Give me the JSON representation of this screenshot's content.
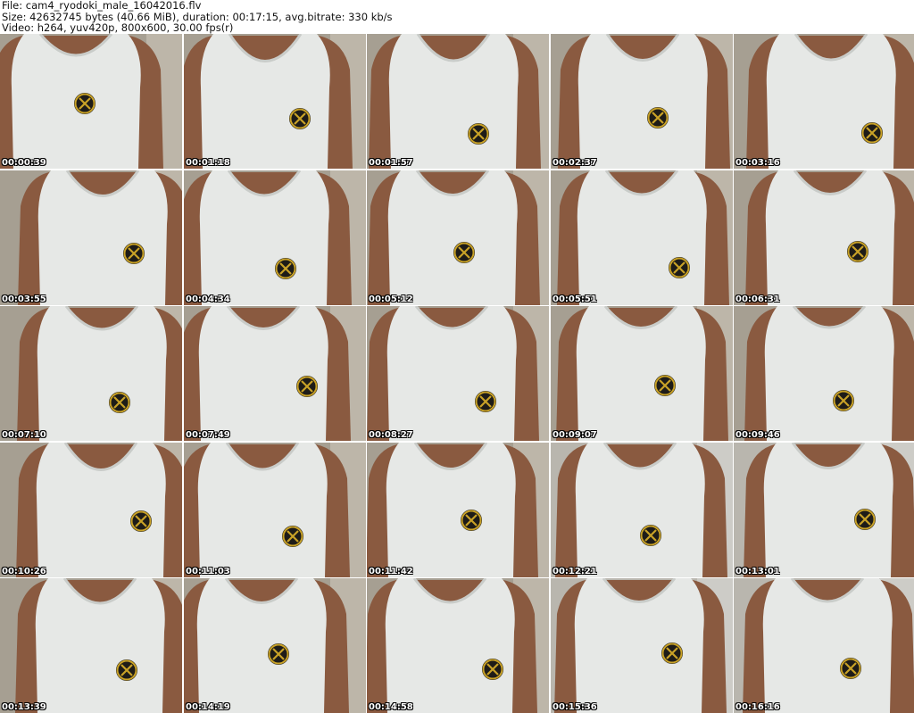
{
  "header": {
    "line1": "File: cam4_ryodoki_male_16042016.flv",
    "line2": "Size: 42632745 bytes (40.66 MiB), duration: 00:17:15, avg.bitrate: 330 kb/s",
    "line3": "Video: h264, yuv420p, 800x600, 30.00 fps(r)"
  },
  "colors": {
    "background": "#ffffff",
    "skin": "#8a5a40",
    "shirt": "#e6e8e6",
    "badge": "#c9a227"
  },
  "thumbnails": [
    {
      "timestamp": "00:00:39"
    },
    {
      "timestamp": "00:01:18"
    },
    {
      "timestamp": "00:01:57"
    },
    {
      "timestamp": "00:02:37"
    },
    {
      "timestamp": "00:03:16"
    },
    {
      "timestamp": "00:03:55"
    },
    {
      "timestamp": "00:04:34"
    },
    {
      "timestamp": "00:05:12"
    },
    {
      "timestamp": "00:05:51"
    },
    {
      "timestamp": "00:06:31"
    },
    {
      "timestamp": "00:07:10"
    },
    {
      "timestamp": "00:07:49"
    },
    {
      "timestamp": "00:08:27"
    },
    {
      "timestamp": "00:09:07"
    },
    {
      "timestamp": "00:09:46"
    },
    {
      "timestamp": "00:10:26"
    },
    {
      "timestamp": "00:11:03"
    },
    {
      "timestamp": "00:11:42"
    },
    {
      "timestamp": "00:12:21"
    },
    {
      "timestamp": "00:13:01"
    },
    {
      "timestamp": "00:13:39"
    },
    {
      "timestamp": "00:14:19"
    },
    {
      "timestamp": "00:14:58"
    },
    {
      "timestamp": "00:15:36"
    },
    {
      "timestamp": "00:16:16"
    }
  ]
}
